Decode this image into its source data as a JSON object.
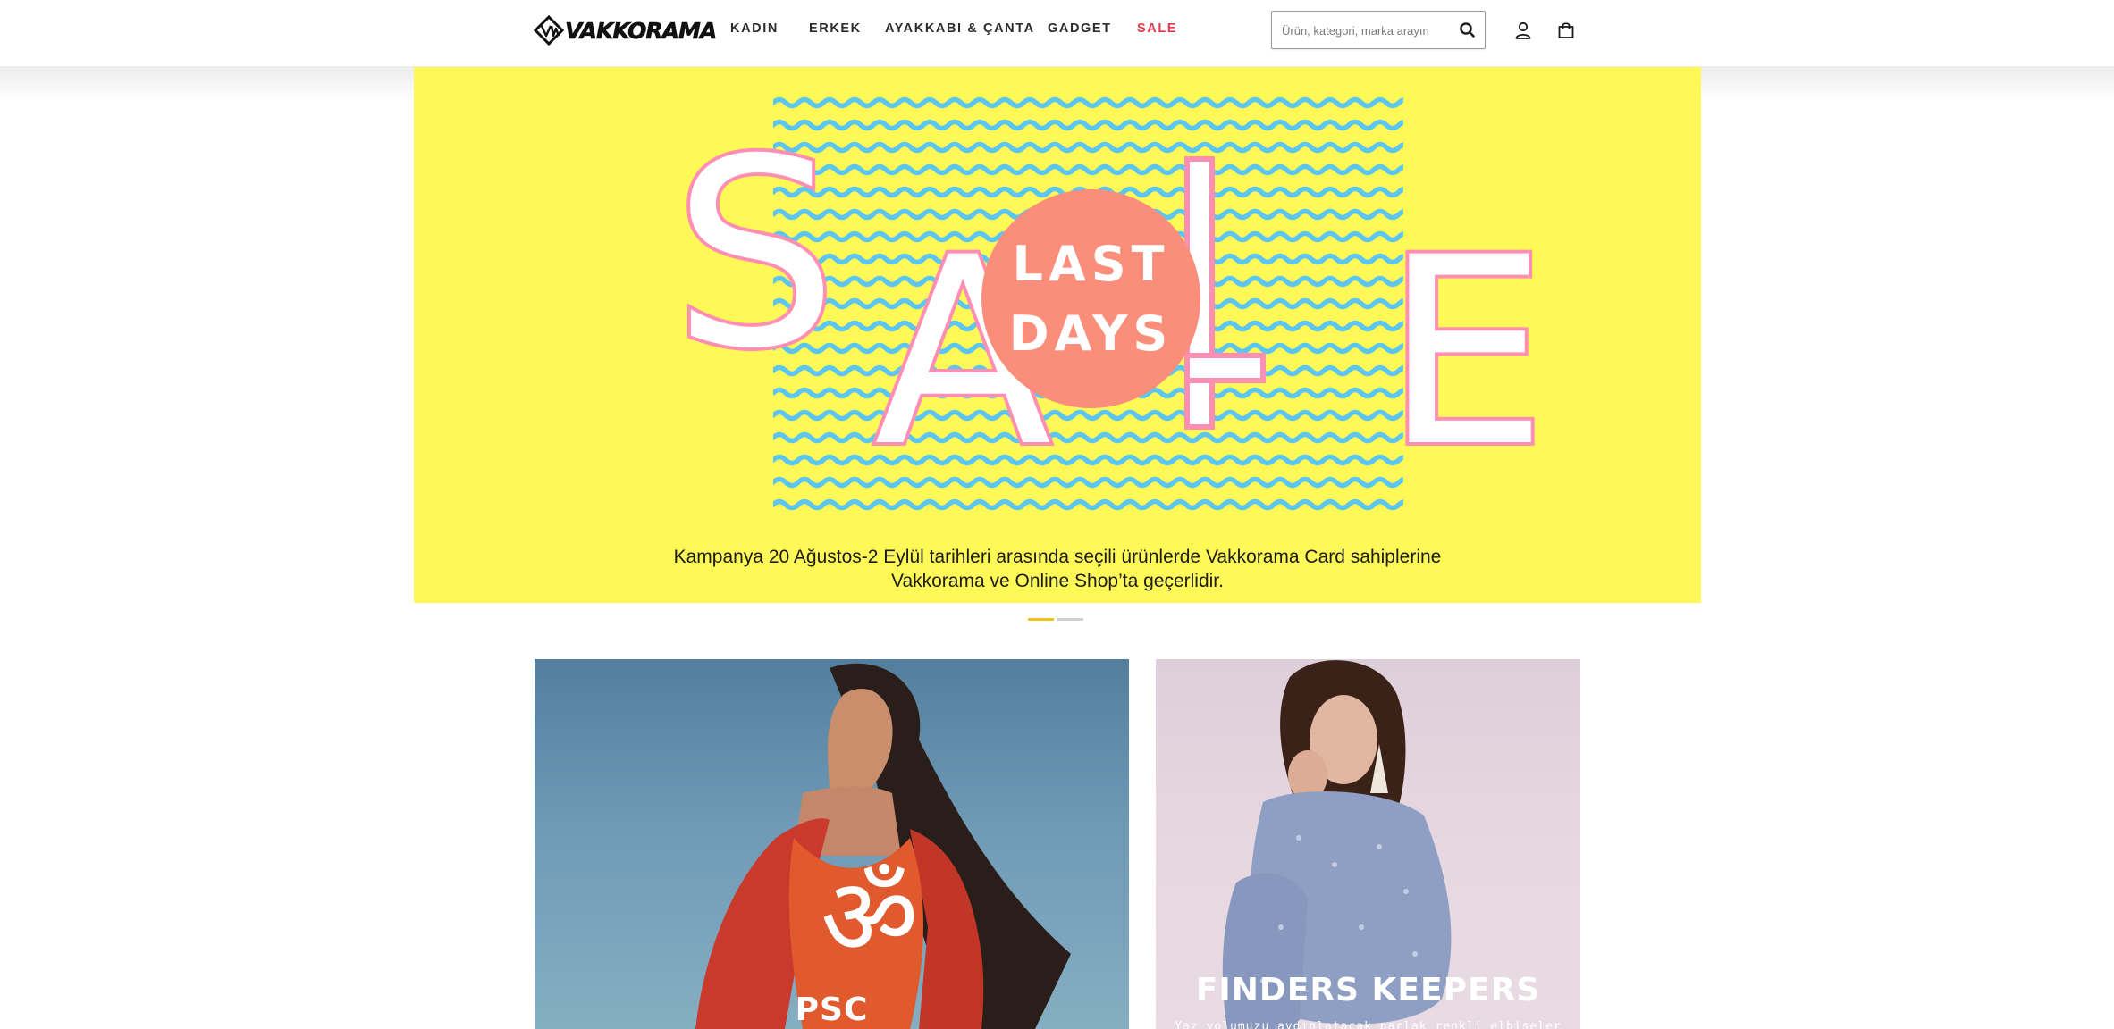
{
  "header": {
    "logo_text": "VAKKORAMA",
    "nav": [
      {
        "label": "KADIN"
      },
      {
        "label": "ERKEK"
      },
      {
        "label": "AYAKKABI & ÇANTA"
      },
      {
        "label": "GADGET"
      },
      {
        "label": "SALE",
        "color": "#e4394d"
      }
    ],
    "search": {
      "placeholder": "Ürün, kategori, marka arayın"
    },
    "icons": [
      "search-icon",
      "user-icon",
      "shopping-bag-icon"
    ]
  },
  "hero": {
    "background_color": "#fff957",
    "headline": "SALE",
    "badge_line1": "LAST",
    "badge_line2": "DAYS",
    "badge_color": "#fb8e7a",
    "wave_color": "#5cc5f0",
    "caption_line1": "Kampanya 20 Ağustos-2 Eylül tarihleri arasında seçili ürünlerde Vakkorama Card sahiplerine",
    "caption_line2": "Vakkorama ve Online Shop’ta geçerlidir."
  },
  "slider": {
    "slides": 2,
    "active_index": 0,
    "active_color": "#f2c224"
  },
  "tiles": [
    {
      "title": "PSC"
    },
    {
      "title": "FINDERS KEEPERS",
      "subtitle": "Yaz yolumuzu aydınlatacak parlak renkli elbiseler"
    }
  ]
}
